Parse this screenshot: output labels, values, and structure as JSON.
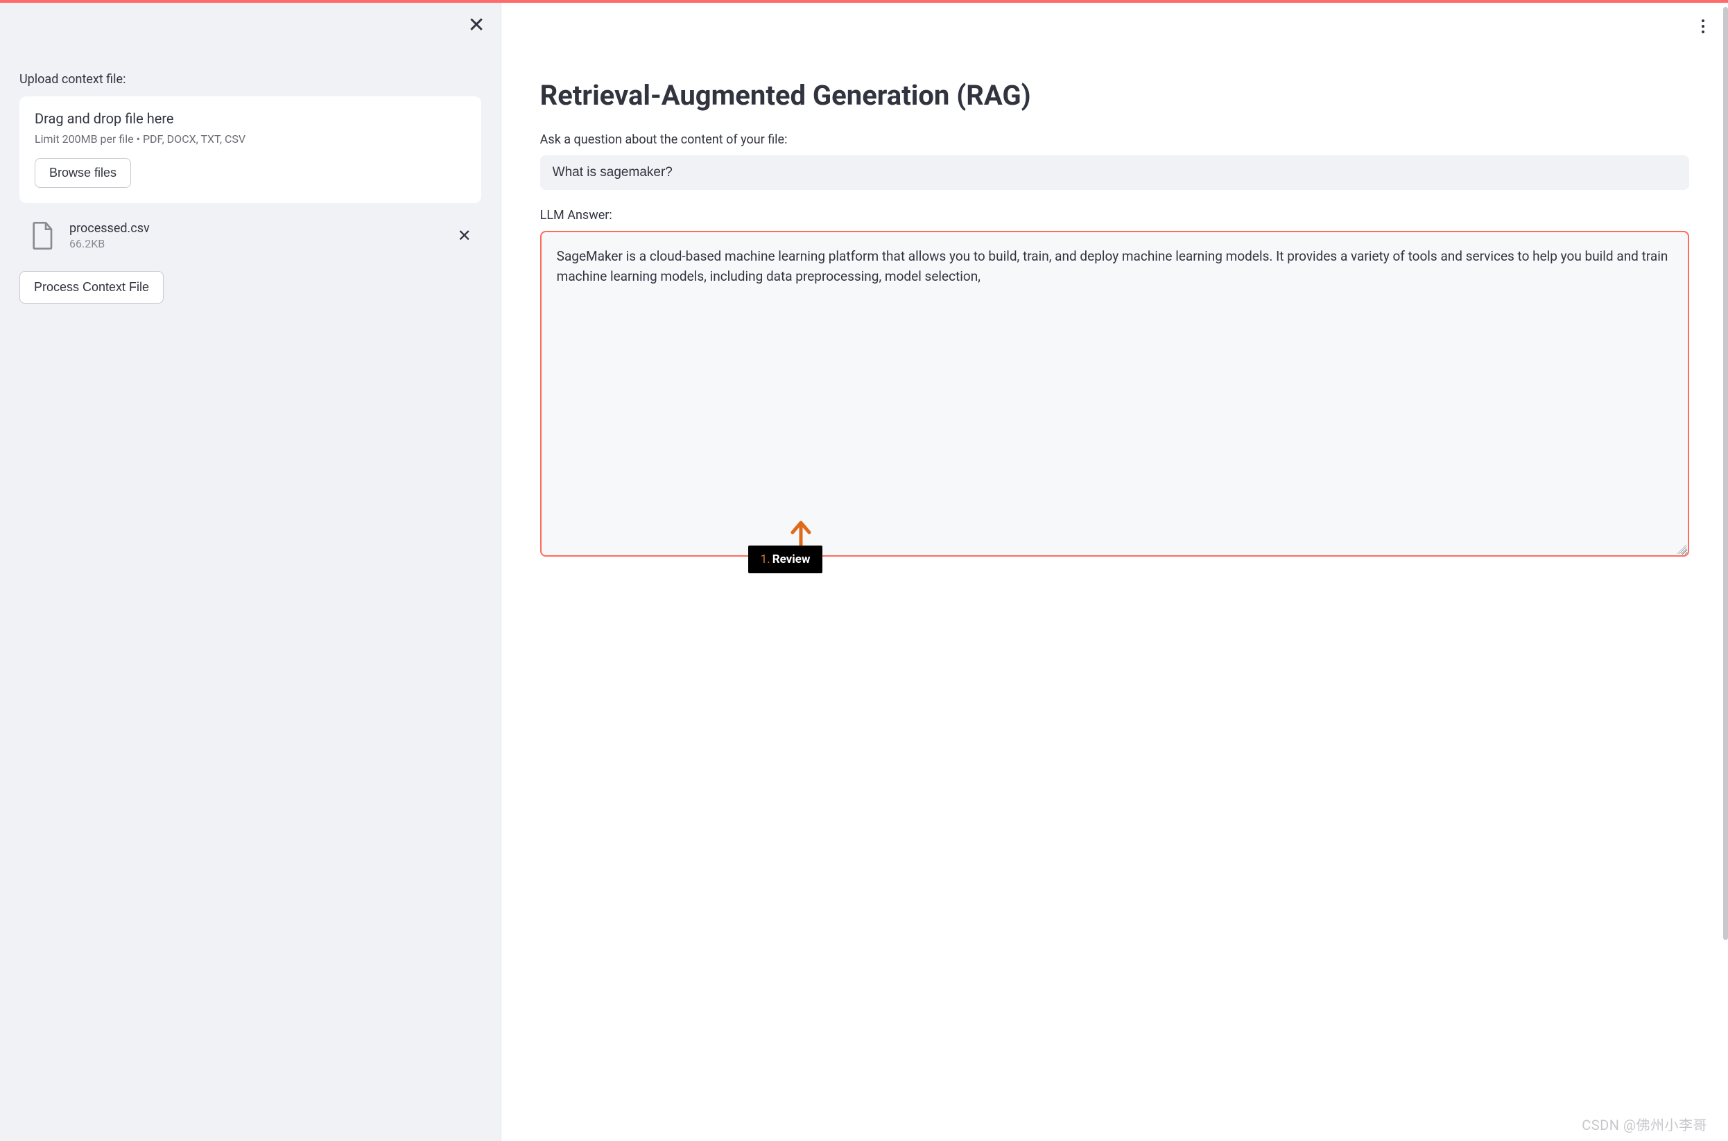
{
  "sidebar": {
    "upload_label": "Upload context file:",
    "drop_title": "Drag and drop file here",
    "drop_hint": "Limit 200MB per file • PDF, DOCX, TXT, CSV",
    "browse_label": "Browse files",
    "file": {
      "name": "processed.csv",
      "size": "66.2KB"
    },
    "process_label": "Process Context File"
  },
  "main": {
    "title": "Retrieval-Augmented Generation (RAG)",
    "question_label": "Ask a question about the content of your file:",
    "question_value": "What is sagemaker?",
    "answer_label": "LLM Answer:",
    "answer_text": " SageMaker is a cloud-based machine learning platform that allows you to build, train, and deploy machine learning models. It provides a variety of tools and services to help you build and train machine learning models, including data preprocessing, model selection,"
  },
  "annotation": {
    "number": "1.",
    "text": "Review"
  },
  "watermark": "CSDN @佛州小李哥",
  "colors": {
    "accent": "#ff6b5b",
    "annotation_arrow": "#e06a1c",
    "sidebar_bg": "#f0f2f6"
  }
}
